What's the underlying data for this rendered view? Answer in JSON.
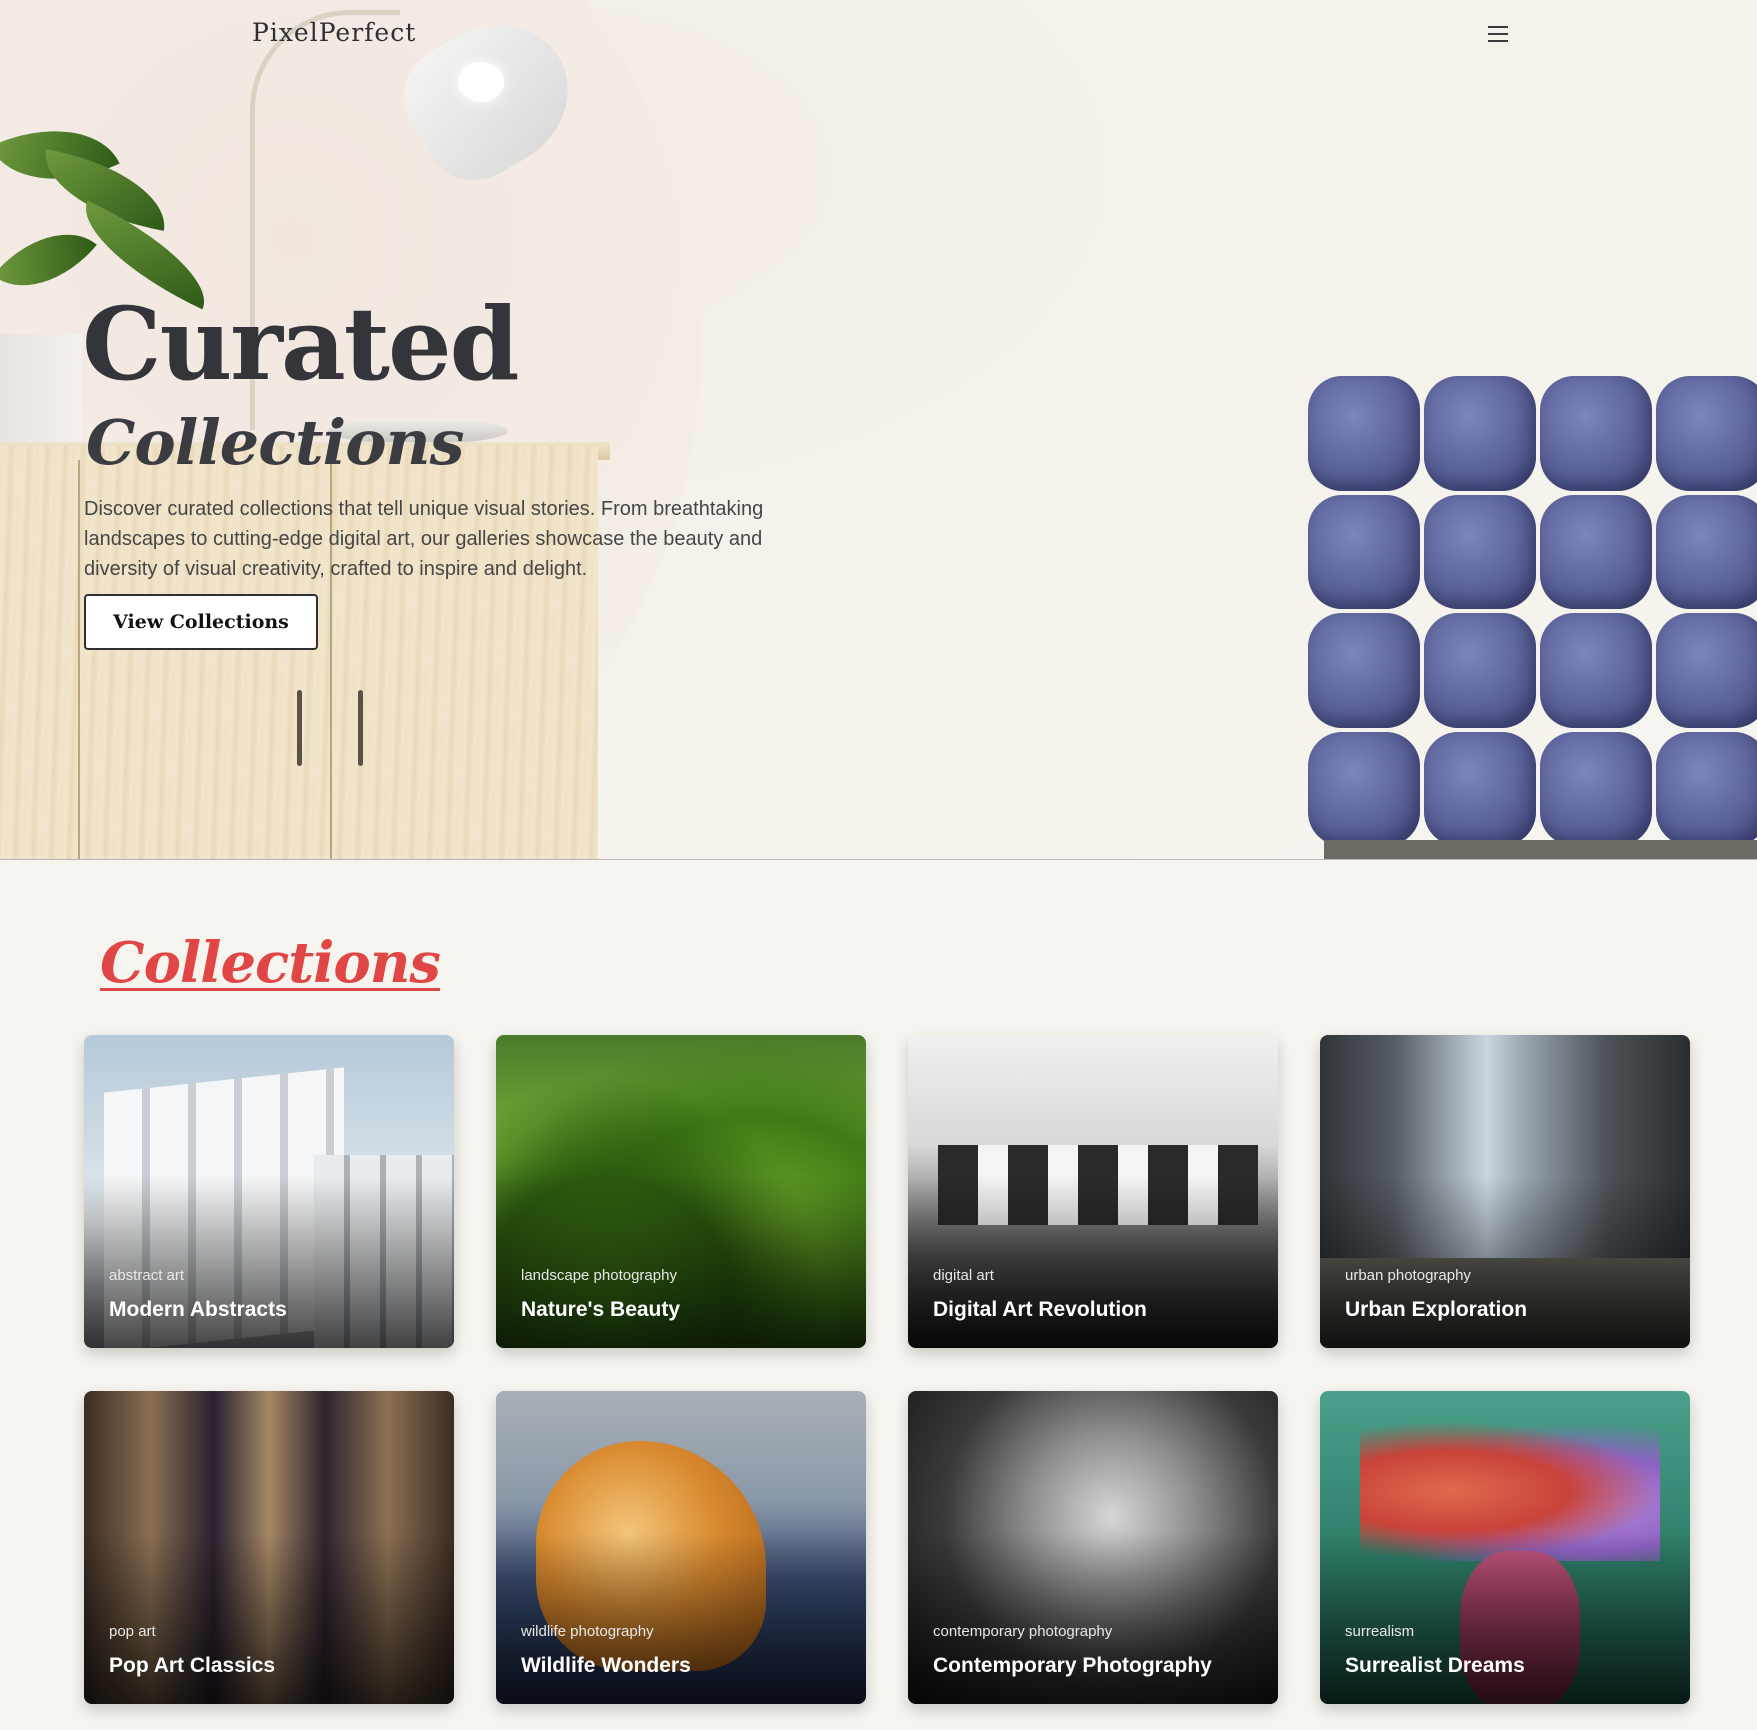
{
  "header": {
    "logo": "PixelPerfect",
    "menu_icon": "hamburger-menu-icon"
  },
  "hero": {
    "title": "Curated",
    "subtitle": "Collections",
    "description": "Discover curated collections that tell unique visual stories. From breathtaking landscapes to cutting-edge digital art, our galleries showcase the beauty and diversity of visual creativity, crafted to inspire and delight.",
    "cta_label": "View Collections"
  },
  "collections": {
    "heading": "Collections",
    "accent_color": "#e04646",
    "items": [
      {
        "category": "abstract art",
        "title": "Modern Abstracts"
      },
      {
        "category": "landscape photography",
        "title": "Nature's Beauty"
      },
      {
        "category": "digital art",
        "title": "Digital Art Revolution"
      },
      {
        "category": "urban photography",
        "title": "Urban Exploration"
      },
      {
        "category": "pop art",
        "title": "Pop Art Classics"
      },
      {
        "category": "wildlife photography",
        "title": "Wildlife Wonders"
      },
      {
        "category": "contemporary photography",
        "title": "Contemporary Photography"
      },
      {
        "category": "surrealism",
        "title": "Surrealist Dreams"
      }
    ]
  }
}
